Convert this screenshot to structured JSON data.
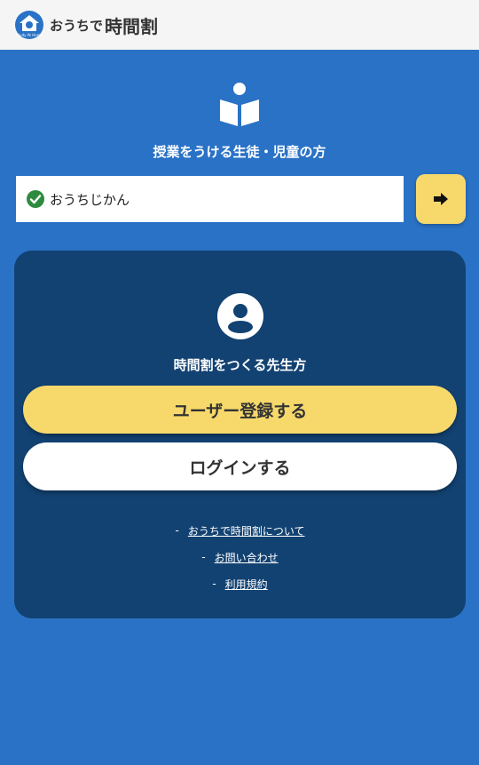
{
  "header": {
    "brand_small": "おうちで",
    "brand_large": "時間割",
    "logo_icon": "house-clock-logo-icon",
    "logo_text": "Study At Home"
  },
  "student_section": {
    "icon": "book-reader-icon",
    "title": "授業をうける生徒・児童の方",
    "class_input_value": "おうちじかん",
    "status_icon": "check-circle-icon",
    "submit_icon": "arrow-right-icon"
  },
  "teacher_section": {
    "icon": "user-circle-icon",
    "title": "時間割をつくる先生方",
    "register_label": "ユーザー登録する",
    "login_label": "ログインする"
  },
  "links": {
    "dash": "-",
    "about": "おうちで時間割について",
    "contact": "お問い合わせ",
    "terms": "利用規約"
  },
  "colors": {
    "background": "#2a72c6",
    "header_bg": "#f5f5f5",
    "panel_bg": "#124272",
    "accent_yellow": "#f7d96b",
    "check_green": "#2e8b3e"
  }
}
